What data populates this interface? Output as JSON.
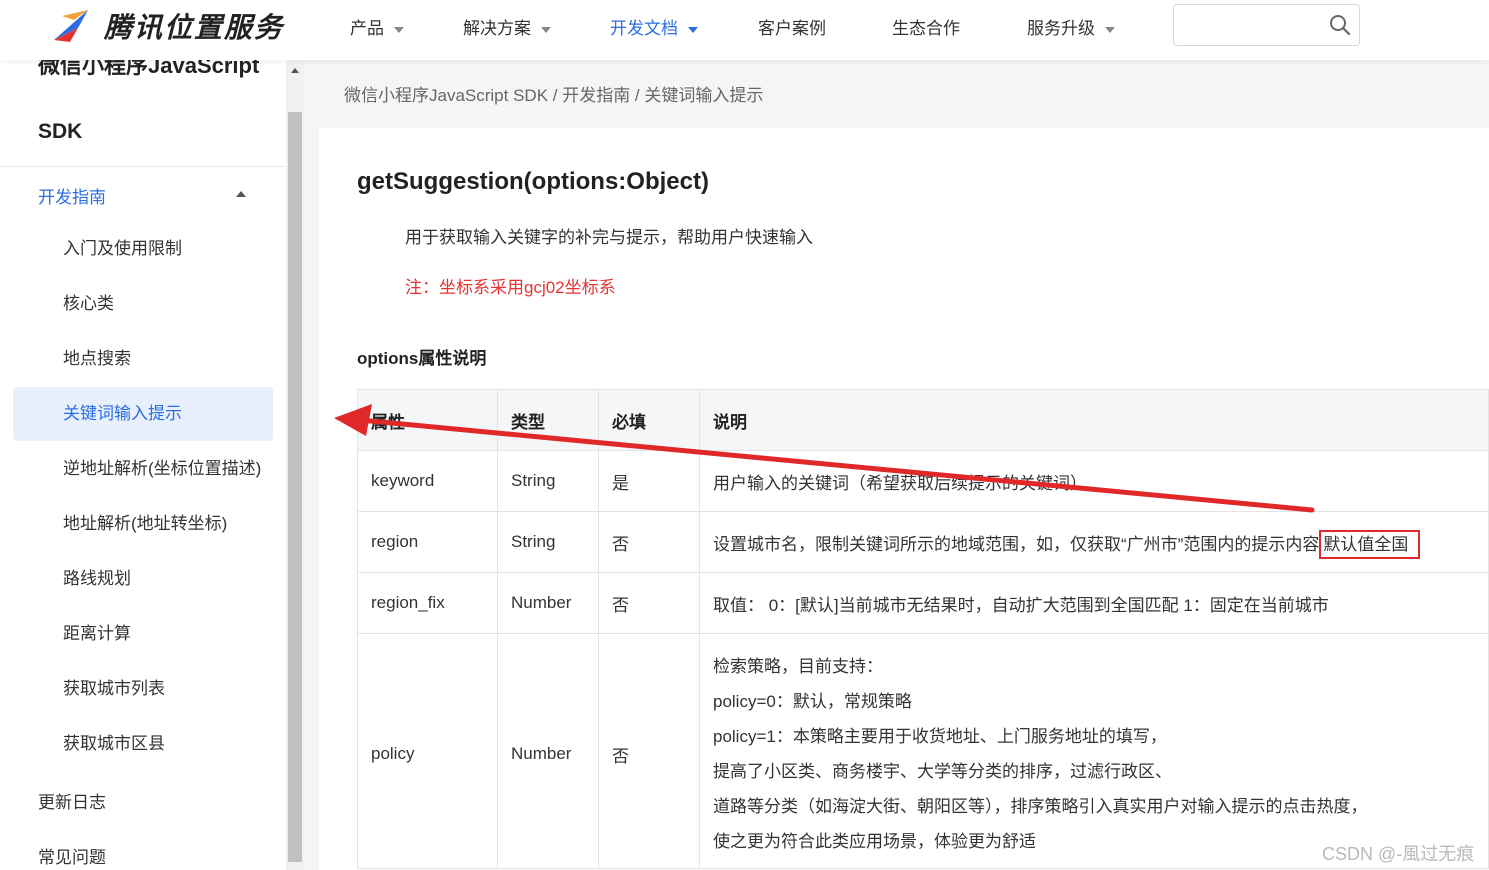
{
  "brand": {
    "name": "腾讯位置服务",
    "accent": "#2b6de5"
  },
  "nav": {
    "items": [
      {
        "label": "产品",
        "dropdown": true,
        "active": false
      },
      {
        "label": "解决方案",
        "dropdown": true,
        "active": false
      },
      {
        "label": "开发文档",
        "dropdown": true,
        "active": true
      },
      {
        "label": "客户案例",
        "dropdown": false,
        "active": false
      },
      {
        "label": "生态合作",
        "dropdown": false,
        "active": false
      },
      {
        "label": "服务升级",
        "dropdown": true,
        "active": false
      }
    ],
    "search_placeholder": ""
  },
  "sidebar": {
    "title_line1": "微信小程序JavaScript",
    "title_line2": "SDK",
    "group_label": "开发指南",
    "items": [
      {
        "label": "入门及使用限制",
        "active": false
      },
      {
        "label": "核心类",
        "active": false
      },
      {
        "label": "地点搜索",
        "active": false
      },
      {
        "label": "关键词输入提示",
        "active": true
      },
      {
        "label": "逆地址解析(坐标位置描述)",
        "active": false
      },
      {
        "label": "地址解析(地址转坐标)",
        "active": false
      },
      {
        "label": "路线规划",
        "active": false
      },
      {
        "label": "距离计算",
        "active": false
      },
      {
        "label": "获取城市列表",
        "active": false
      },
      {
        "label": "获取城市区县",
        "active": false
      }
    ],
    "top_items": [
      {
        "label": "更新日志"
      },
      {
        "label": "常见问题"
      }
    ]
  },
  "breadcrumb": "微信小程序JavaScript SDK / 开发指南 / 关键词输入提示",
  "main": {
    "function_title": "getSuggestion(options:Object)",
    "description": "用于获取输入关键字的补完与提示，帮助用户快速输入",
    "note": "注：坐标系采用gcj02坐标系",
    "options_title": "options属性说明",
    "table": {
      "headers": [
        "属性",
        "类型",
        "必填",
        "说明"
      ],
      "rows": [
        {
          "attr": "keyword",
          "type": "String",
          "required": "是",
          "desc": "用户输入的关键词（希望获取后续提示的关键词）"
        },
        {
          "attr": "region",
          "type": "String",
          "required": "否",
          "desc": "设置城市名，限制关键词所示的地域范围，如，仅获取“广州市”范围内的提示内容",
          "desc_highlight": "默认值全国"
        },
        {
          "attr": "region_fix",
          "type": "Number",
          "required": "否",
          "desc": "取值： 0：[默认]当前城市无结果时，自动扩大范围到全国匹配 1：固定在当前城市"
        },
        {
          "attr": "policy",
          "type": "Number",
          "required": "否",
          "desc_lines": [
            "检索策略，目前支持：",
            "policy=0：默认，常规策略",
            "policy=1：本策略主要用于收货地址、上门服务地址的填写，",
            "提高了小区类、商务楼宇、大学等分类的排序，过滤行政区、",
            "道路等分类（如海淀大街、朝阳区等），排序策略引入真实用户对输入提示的点击热度，",
            "使之更为符合此类应用场景，体验更为舒适"
          ]
        }
      ]
    }
  },
  "annotation": {
    "arrow_color": "#e02828"
  },
  "watermark": "CSDN @-風过无痕"
}
